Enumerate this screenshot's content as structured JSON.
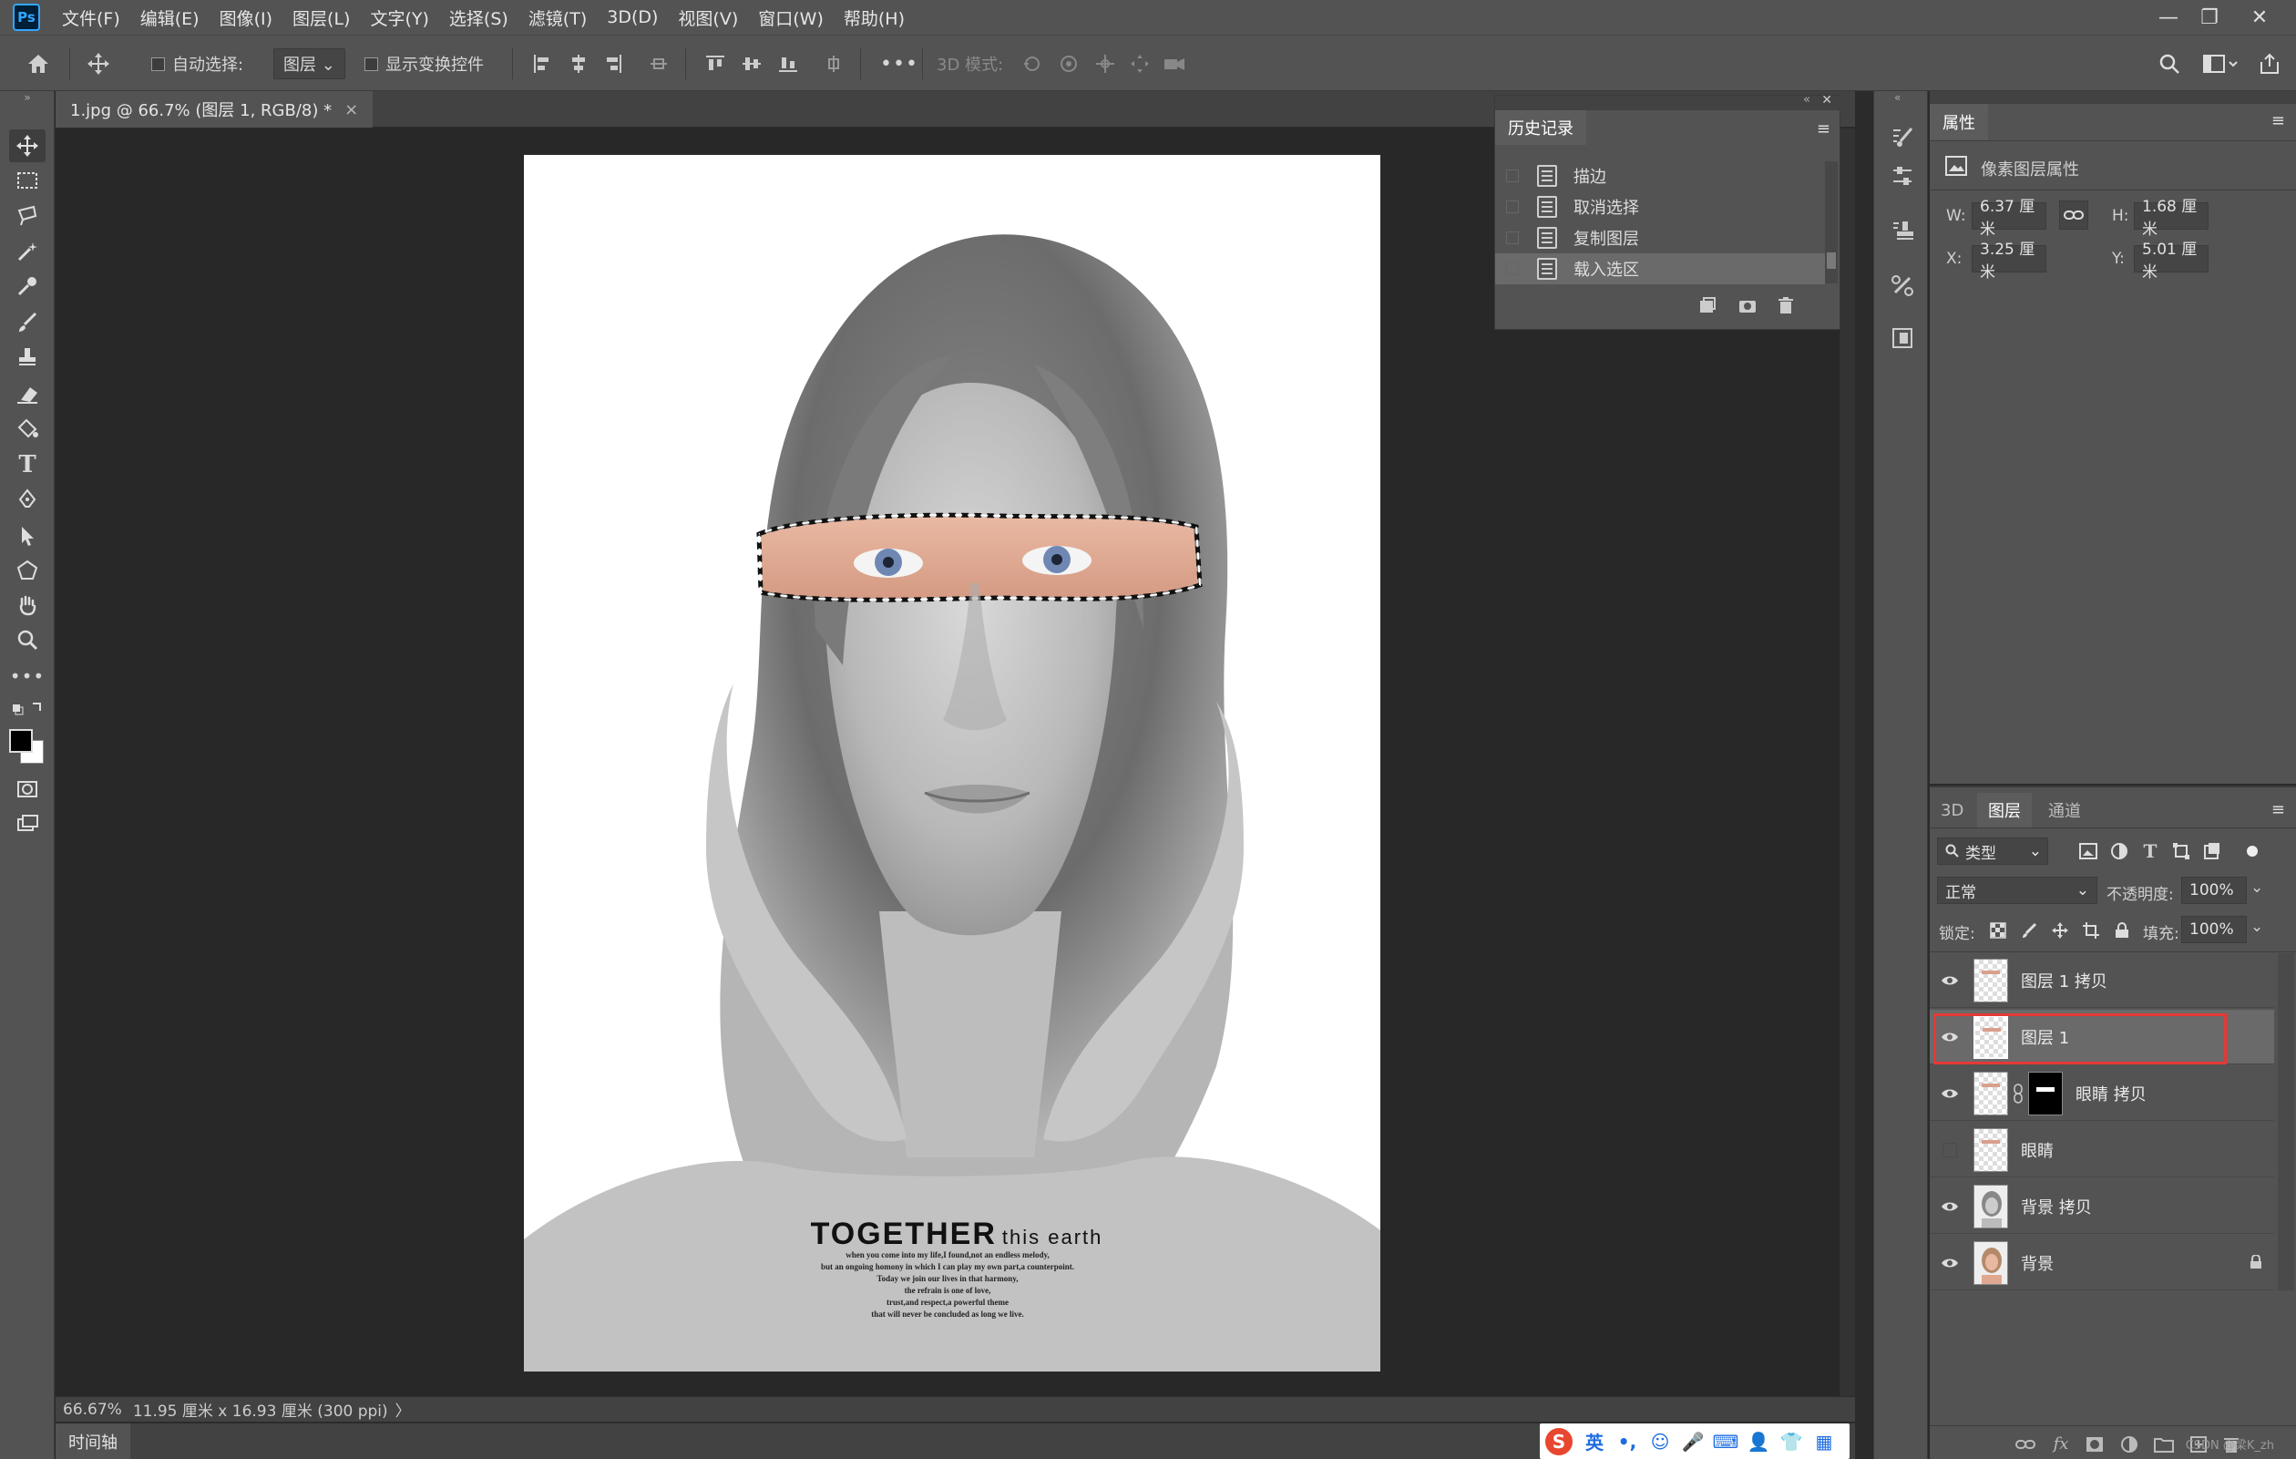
{
  "app": {
    "logo": "Ps"
  },
  "menu": [
    "文件(F)",
    "编辑(E)",
    "图像(I)",
    "图层(L)",
    "文字(Y)",
    "选择(S)",
    "滤镜(T)",
    "3D(D)",
    "视图(V)",
    "窗口(W)",
    "帮助(H)"
  ],
  "window_controls": {
    "minimize": "—",
    "restore": "❐",
    "close": "✕"
  },
  "options": {
    "auto_select_label": "自动选择:",
    "auto_select_target": "图层",
    "show_transform_label": "显示变换控件",
    "more": "•••",
    "mode_3d_label": "3D 模式:"
  },
  "document": {
    "tab_title": "1.jpg @ 66.7% (图层 1, RGB/8) *",
    "tab_close": "×",
    "zoom": "66.67%",
    "doc_info": "11.95 厘米 x 16.93 厘米 (300 ppi)",
    "info_arrow": "〉"
  },
  "artwork": {
    "headline_bold": "TOGETHER",
    "headline_light": "this earth",
    "body_lines": [
      "when you come into my life,I found,not an endless melody,",
      "but an ongoing homony in which I can play my own part,a counterpoint.",
      "Today we join our lives in that harmony,",
      "the refrain is one of love,",
      "trust,and respect,a powerful theme",
      "that will never be concluded as long we live."
    ]
  },
  "history": {
    "title": "历史记录",
    "items": [
      "描边",
      "取消选择",
      "复制图层",
      "载入选区"
    ],
    "active_index": 3
  },
  "properties": {
    "title": "属性",
    "subtitle": "像素图层属性",
    "w_label": "W:",
    "w_value": "6.37 厘米",
    "h_label": "H:",
    "h_value": "1.68 厘米",
    "x_label": "X:",
    "x_value": "3.25 厘米",
    "y_label": "Y:",
    "y_value": "5.01 厘米"
  },
  "layers_panel": {
    "tabs": [
      "3D",
      "图层",
      "通道"
    ],
    "active_tab": 1,
    "filter_label": "类型",
    "blend_mode": "正常",
    "opacity_label": "不透明度:",
    "opacity_value": "100%",
    "lock_label": "锁定:",
    "fill_label": "填充:",
    "fill_value": "100%",
    "layers": [
      {
        "name": "图层 1 拷贝",
        "visible": true,
        "selected": false,
        "thumb": "transparent"
      },
      {
        "name": "图层 1",
        "visible": true,
        "selected": true,
        "thumb": "transparent"
      },
      {
        "name": "眼睛 拷贝",
        "visible": true,
        "selected": false,
        "thumb": "transparent-mask"
      },
      {
        "name": "眼睛",
        "visible": false,
        "selected": false,
        "thumb": "transparent"
      },
      {
        "name": "背景 拷贝",
        "visible": true,
        "selected": false,
        "thumb": "photo-gray"
      },
      {
        "name": "背景",
        "visible": true,
        "selected": false,
        "thumb": "photo-color",
        "locked": true
      }
    ],
    "footer_icons": [
      "link-icon",
      "fx-icon",
      "mask-icon",
      "adjustment-icon",
      "folder-icon",
      "new-layer-icon",
      "trash-icon"
    ],
    "watermark": "CSDN @梁K_zh"
  },
  "timeline": {
    "label": "时间轴"
  },
  "ime": {
    "items": [
      "S",
      "英",
      "•,",
      "☺",
      "🎤",
      "⌨",
      "👤",
      "👕",
      "▦"
    ]
  },
  "colors": {
    "accent": "#31a8ff",
    "selection_outline": "#e53935",
    "panel": "#535353",
    "canvas_bg": "#282828"
  }
}
